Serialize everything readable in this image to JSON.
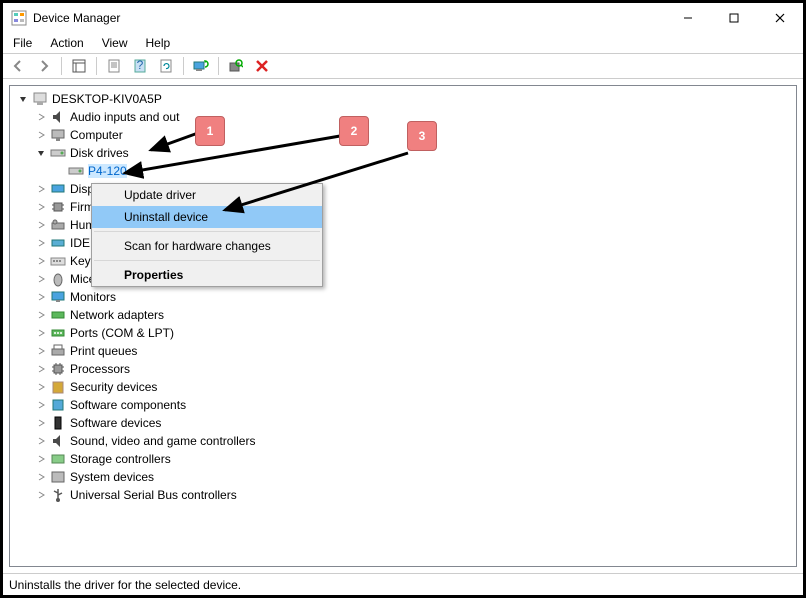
{
  "window": {
    "title": "Device Manager"
  },
  "menu": {
    "file": "File",
    "action": "Action",
    "view": "View",
    "help": "Help"
  },
  "tree": {
    "root": "DESKTOP-KIV0A5P",
    "nodes": [
      {
        "label": "Audio inputs and out"
      },
      {
        "label": "Computer"
      },
      {
        "label": "Disk drives",
        "expanded": true,
        "children": [
          {
            "label": "P4-120"
          }
        ]
      },
      {
        "label": "Displ"
      },
      {
        "label": "Firm"
      },
      {
        "label": "Hum"
      },
      {
        "label": "IDE A"
      },
      {
        "label": "Keyb"
      },
      {
        "label": "Mice"
      },
      {
        "label": "Monitors"
      },
      {
        "label": "Network adapters"
      },
      {
        "label": "Ports (COM & LPT)"
      },
      {
        "label": "Print queues"
      },
      {
        "label": "Processors"
      },
      {
        "label": "Security devices"
      },
      {
        "label": "Software components"
      },
      {
        "label": "Software devices"
      },
      {
        "label": "Sound, video and game controllers"
      },
      {
        "label": "Storage controllers"
      },
      {
        "label": "System devices"
      },
      {
        "label": "Universal Serial Bus controllers"
      }
    ]
  },
  "context_menu": {
    "items": {
      "update": "Update driver",
      "uninstall": "Uninstall device",
      "scan": "Scan for hardware changes",
      "properties": "Properties"
    }
  },
  "status_bar": {
    "text": "Uninstalls the driver for the selected device."
  },
  "annotations": {
    "one": "1",
    "two": "2",
    "three": "3"
  },
  "icon_colors": {
    "speaker": "#4a4a4a",
    "computer": "#7a7a7a",
    "disk": "#7a7a7a",
    "monitor": "#4aa3df",
    "chip": "#8a8a8a",
    "hid": "#6a6a6a",
    "ide": "#5aaed4",
    "keyboard": "#9a9a9a",
    "mouse": "#6a6a6a",
    "network": "#5cb85c",
    "port": "#5cb85c",
    "printer": "#7a7a7a",
    "security": "#d4a838",
    "software": "#54a9d8",
    "sound": "#6a6a6a",
    "storage": "#6a6a6a",
    "system": "#6a6a6a",
    "usb": "#6a6a6a",
    "red_x": "#d22",
    "green_refresh": "#0a0"
  }
}
